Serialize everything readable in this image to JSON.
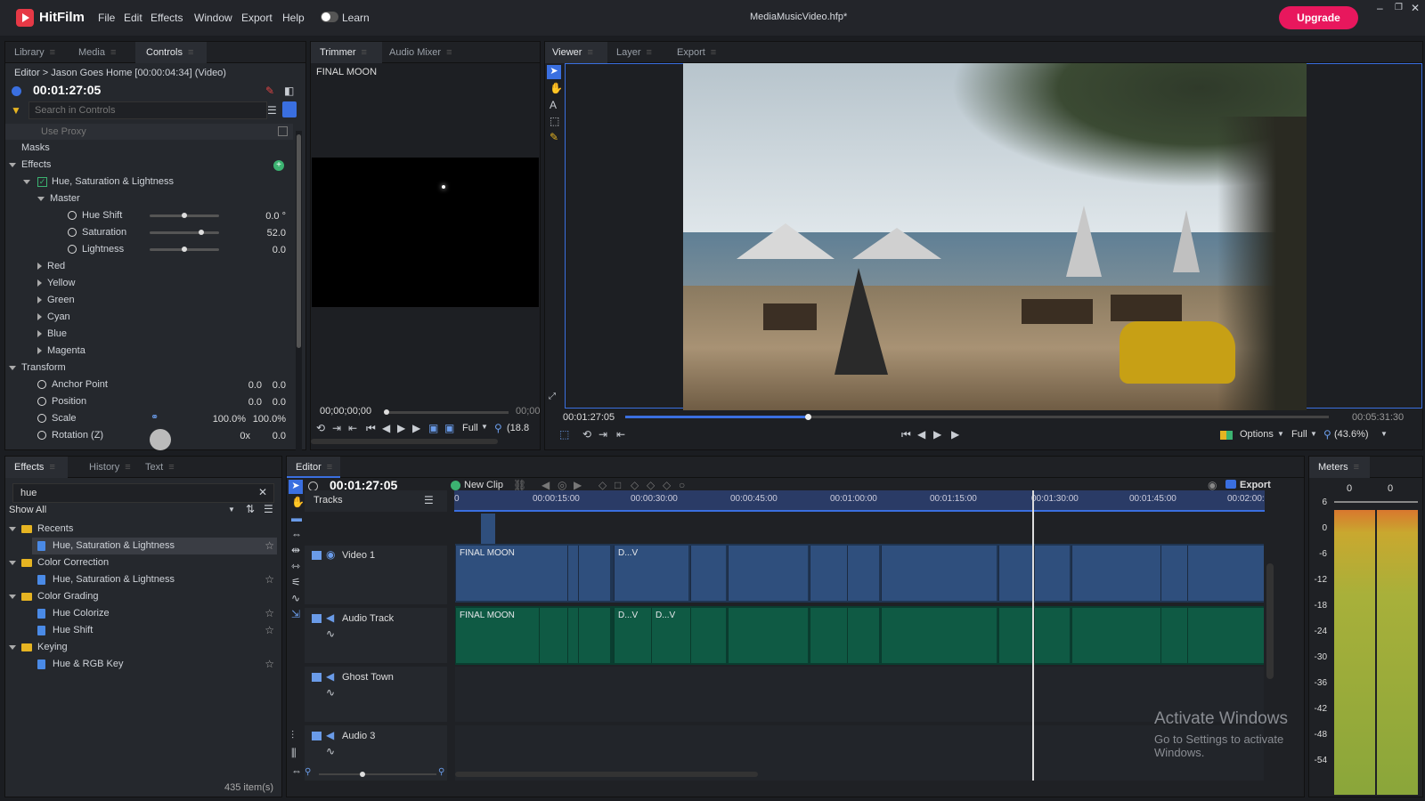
{
  "app": {
    "name": "HitFilm",
    "file_title": "MediaMusicVideo.hfp*",
    "learn_label": "Learn",
    "upgrade_label": "Upgrade"
  },
  "menu": [
    "File",
    "Edit",
    "Effects",
    "Window",
    "Export",
    "Help"
  ],
  "controls_panel": {
    "tabs": [
      "Library",
      "Media",
      "Controls"
    ],
    "breadcrumb": "Editor > Jason Goes Home [00:00:04:34] (Video)",
    "time": "00:01:27:05",
    "search_placeholder": "Search in Controls",
    "use_proxy": "Use Proxy",
    "masks": "Masks",
    "effects": "Effects",
    "effect_name": "Hue, Saturation & Lightness",
    "master": "Master",
    "params": [
      {
        "label": "Hue Shift",
        "value": "0.0 °",
        "level": 0.5
      },
      {
        "label": "Saturation",
        "value": "52.0",
        "level": 0.74
      },
      {
        "label": "Lightness",
        "value": "0.0",
        "level": 0.5
      }
    ],
    "color_groups": [
      "Red",
      "Yellow",
      "Green",
      "Cyan",
      "Blue",
      "Magenta"
    ],
    "transform": "Transform",
    "transform_params": [
      {
        "label": "Anchor Point",
        "v1": "0.0",
        "v2": "0.0"
      },
      {
        "label": "Position",
        "v1": "0.0",
        "v2": "0.0"
      },
      {
        "label": "Scale",
        "v1": "100.0%",
        "v2": "100.0%"
      },
      {
        "label": "Rotation (Z)",
        "v1": "0x",
        "v2": "0.0"
      }
    ]
  },
  "trimmer": {
    "tabs": [
      "Trimmer",
      "Audio Mixer"
    ],
    "clip_name": "FINAL MOON",
    "timecode": "00;00;00;00",
    "timecode_end": "00;00",
    "quality": "Full",
    "zoom": "(18.8"
  },
  "viewer": {
    "tabs": [
      "Viewer",
      "Layer",
      "Export"
    ],
    "time_current": "00:01:27:05",
    "time_total": "00:05:31:30",
    "options_label": "Options",
    "quality": "Full",
    "zoom": "(43.6%)",
    "playhead": 0.26
  },
  "effects_panel": {
    "tabs": [
      "Effects",
      "History",
      "Text"
    ],
    "search_value": "hue",
    "filter": "Show All",
    "groups": [
      {
        "name": "Recents",
        "items": [
          "Hue, Saturation & Lightness"
        ]
      },
      {
        "name": "Color Correction",
        "items": [
          "Hue, Saturation & Lightness"
        ]
      },
      {
        "name": "Color Grading",
        "items": [
          "Hue Colorize",
          "Hue Shift"
        ]
      },
      {
        "name": "Keying",
        "items": [
          "Hue & RGB Key"
        ]
      }
    ],
    "count": "435 item(s)"
  },
  "editor": {
    "tab": "Editor",
    "time": "00:01:27:05",
    "new_clip": "New Clip",
    "export_label": "Export",
    "tracks_label": "Tracks",
    "ruler": [
      "0",
      "00:00:15:00",
      "00:00:30:00",
      "00:00:45:00",
      "00:01:00:00",
      "00:01:15:00",
      "00:01:30:00",
      "00:01:45:00",
      "00:02:00:"
    ],
    "tracks": [
      "Video 1",
      "Audio Track",
      "Ghost Town",
      "Audio 3"
    ],
    "clip_labels": [
      "FINAL MOON",
      "D...V",
      "D...V"
    ]
  },
  "meters": {
    "tab": "Meters",
    "left": "0",
    "right": "0",
    "scale": [
      "6",
      "0",
      "-6",
      "-12",
      "-18",
      "-24",
      "-30",
      "-36",
      "-42",
      "-48",
      "-54"
    ]
  },
  "watermark": {
    "title": "Activate Windows",
    "sub": "Go to Settings to activate Windows."
  },
  "colors": {
    "accent": "#e8175d",
    "video_clip": "#2f4f7d",
    "audio_clip": "#0f5a44",
    "selection": "#3a6fe0"
  }
}
